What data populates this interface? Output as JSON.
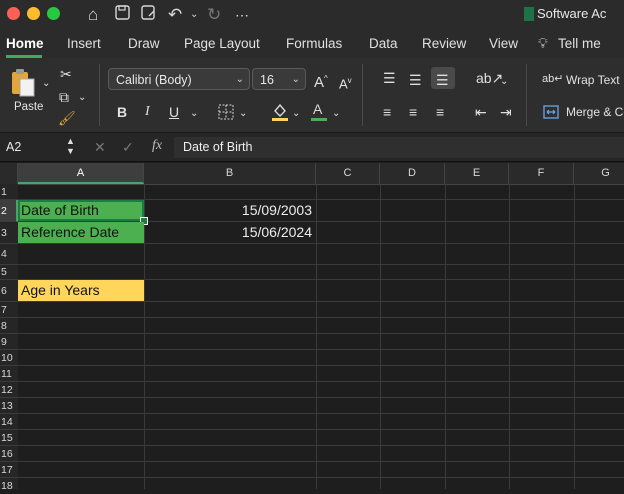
{
  "window": {
    "title": "Software Ac",
    "traffic_lights": [
      "#fe5f57",
      "#febc2e",
      "#28c840"
    ]
  },
  "menu": {
    "tabs": [
      {
        "label": "Home",
        "active": true
      },
      {
        "label": "Insert"
      },
      {
        "label": "Draw"
      },
      {
        "label": "Page Layout"
      },
      {
        "label": "Formulas"
      },
      {
        "label": "Data"
      },
      {
        "label": "Review"
      },
      {
        "label": "View"
      },
      {
        "label": "Tell me"
      }
    ]
  },
  "ribbon": {
    "paste_label": "Paste",
    "font_name": "Calibri (Body)",
    "font_size": "16",
    "wrap_text": "Wrap Text",
    "merge_center": "Merge & Ce",
    "bold": "B",
    "italic": "I",
    "underline": "U"
  },
  "formula_bar": {
    "cell_ref": "A2",
    "content": "Date of Birth",
    "fx": "fx"
  },
  "sheet": {
    "columns": [
      "A",
      "B",
      "C",
      "D",
      "E",
      "F",
      "G"
    ],
    "rows": [
      "1",
      "2",
      "3",
      "4",
      "5",
      "6",
      "7",
      "8",
      "9",
      "10",
      "11",
      "12",
      "13",
      "14",
      "15",
      "16",
      "17",
      "18"
    ],
    "cells": {
      "a2": "Date of Birth",
      "b2": "15/09/2003",
      "a3": "Reference Date",
      "b3": "15/06/2024",
      "a6": "Age in Years"
    },
    "colors": {
      "green_fill": "#4caf50",
      "yellow_fill": "#ffd65a",
      "selection": "#1e7b45"
    }
  }
}
